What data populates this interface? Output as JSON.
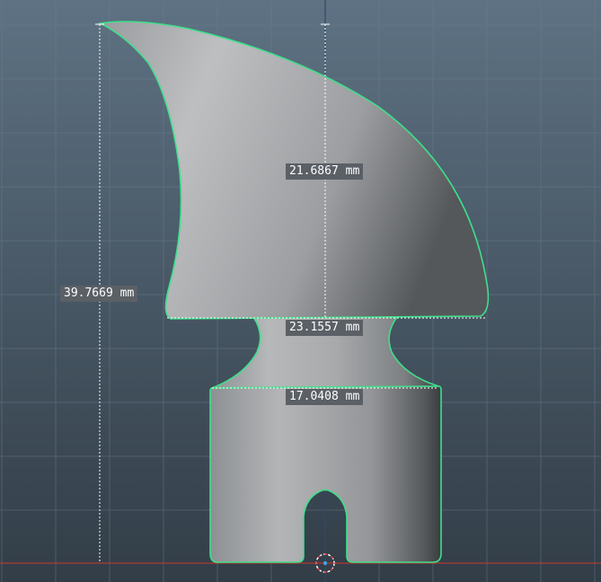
{
  "viewport": {
    "background_top": "#5e7283",
    "background_bottom": "#323d47",
    "grid_color": "#6b7f8f",
    "outline_color": "#3ee08a",
    "ground_line_color": "#c0392b"
  },
  "dimensions": {
    "fin_width": "21.6867 mm",
    "total_height": "39.7669 mm",
    "neck_width": "23.1557 mm",
    "base_width": "17.0408 mm"
  },
  "pivot": {
    "icon": "pivot-target-icon"
  }
}
